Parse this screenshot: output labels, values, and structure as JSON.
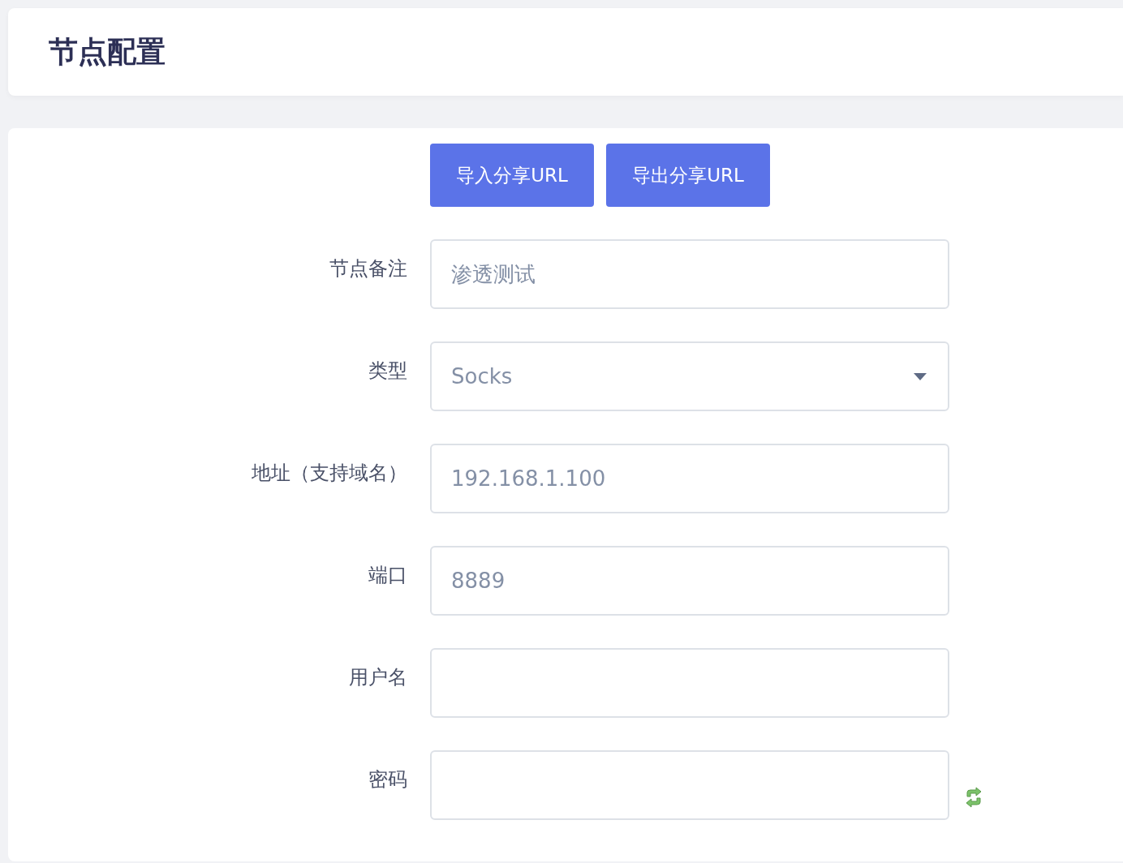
{
  "header": {
    "title": "节点配置"
  },
  "buttons": [
    {
      "label": "导入分享URL"
    },
    {
      "label": "导出分享URL"
    }
  ],
  "fields": [
    {
      "label": "节点备注",
      "kind": "text",
      "value": "渗透测试"
    },
    {
      "label": "类型",
      "kind": "select",
      "value": "Socks"
    },
    {
      "label": "地址（支持域名）",
      "kind": "text",
      "value": "192.168.1.100"
    },
    {
      "label": "端口",
      "kind": "text",
      "value": "8889"
    },
    {
      "label": "用户名",
      "kind": "text"
    },
    {
      "label": "密码",
      "kind": "password"
    }
  ]
}
